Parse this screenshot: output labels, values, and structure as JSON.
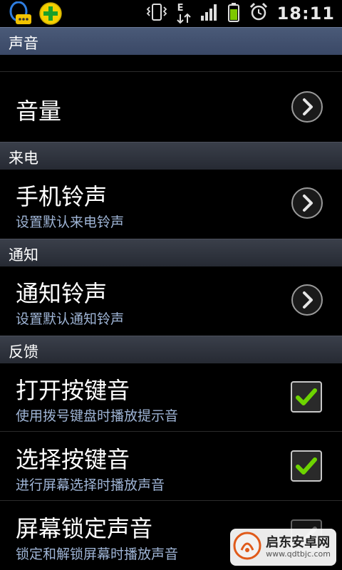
{
  "status_bar": {
    "time": "18:11",
    "network_letter": "E",
    "icons": [
      "qq-icon",
      "360-plus-icon",
      "vibrate-icon",
      "data-arrows-icon",
      "signal-icon",
      "battery-icon",
      "alarm-icon"
    ]
  },
  "sections": {
    "sound": {
      "header": "声音",
      "volume": {
        "title": "音量"
      }
    },
    "incoming": {
      "header": "来电",
      "ringtone": {
        "title": "手机铃声",
        "summary": "设置默认来电铃声"
      }
    },
    "notify": {
      "header": "通知",
      "ringtone": {
        "title": "通知铃声",
        "summary": "设置默认通知铃声"
      }
    },
    "feedback": {
      "header": "反馈",
      "dial_tone": {
        "title": "打开按键音",
        "summary": "使用拨号键盘时播放提示音",
        "checked": true
      },
      "touch_tone": {
        "title": "选择按键音",
        "summary": "进行屏幕选择时播放声音",
        "checked": true
      },
      "lock_sound": {
        "title": "屏幕锁定声音",
        "summary": "锁定和解锁屏幕时播放声音",
        "checked": true
      }
    }
  },
  "watermark": {
    "name": "启东安卓网",
    "url": "www.qdtbjc.com"
  },
  "colors": {
    "header_blue": "#3a4866",
    "summary_blue": "#9fb5d6",
    "check_green": "#6dd400"
  }
}
